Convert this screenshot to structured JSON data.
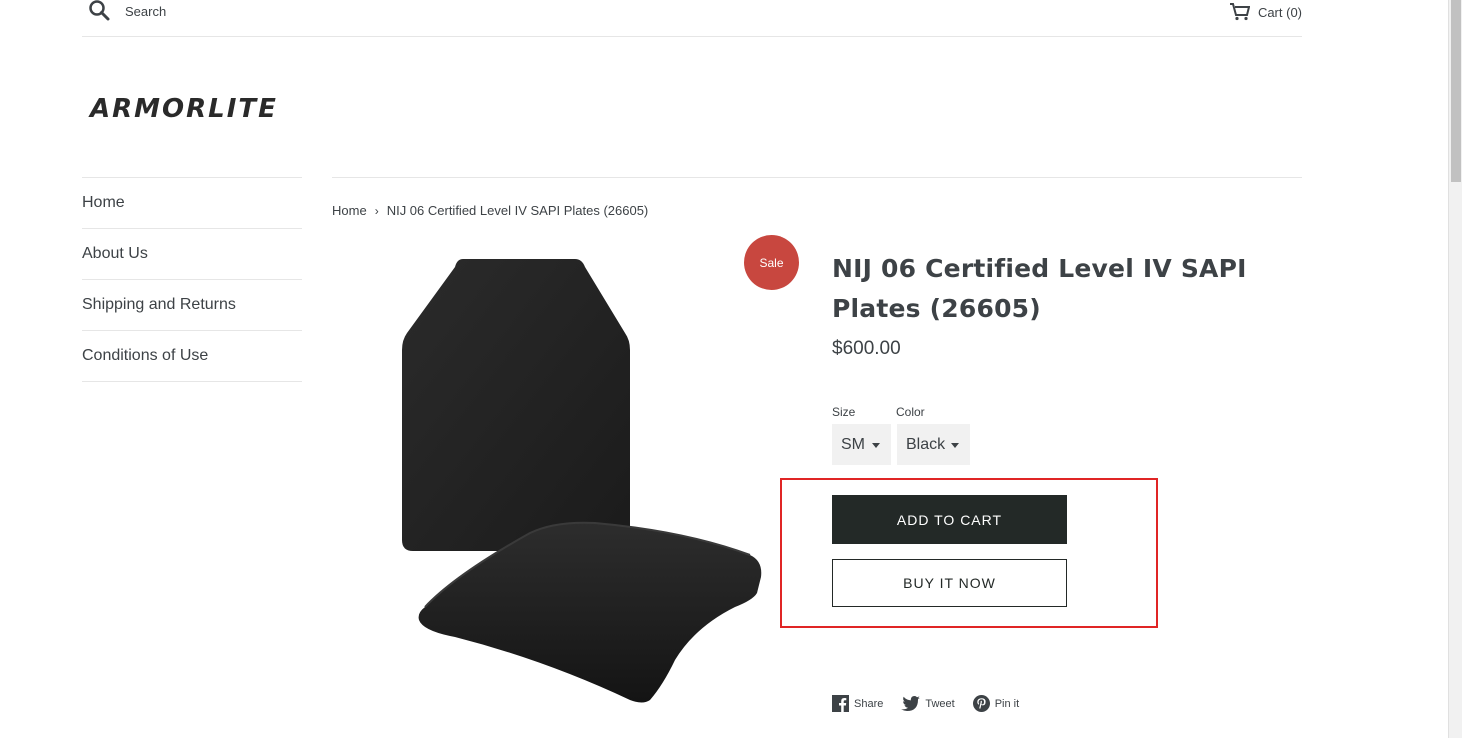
{
  "header": {
    "search_label": "Search",
    "cart_label": "Cart (0)"
  },
  "logo": {
    "text": "ARMORLITE"
  },
  "sidebar": {
    "items": [
      {
        "label": "Home"
      },
      {
        "label": "About Us"
      },
      {
        "label": "Shipping and Returns"
      },
      {
        "label": "Conditions of Use"
      }
    ]
  },
  "breadcrumb": {
    "home": "Home",
    "separator": "›",
    "current": "NIJ 06 Certified Level IV SAPI Plates (26605)"
  },
  "product": {
    "badge": "Sale",
    "title": "NIJ 06 Certified Level IV SAPI Plates (26605)",
    "price": "$600.00",
    "options": {
      "size_label": "Size",
      "size_value": "SM",
      "color_label": "Color",
      "color_value": "Black"
    },
    "add_to_cart": "ADD TO CART",
    "buy_now": "BUY IT NOW"
  },
  "share": {
    "facebook": "Share",
    "twitter": "Tweet",
    "pinterest": "Pin it"
  },
  "colors": {
    "sale_badge": "#c8473f",
    "button_dark": "#232927",
    "highlight": "#e02525",
    "text": "#3d4246"
  },
  "icons": {
    "search": "search-icon",
    "cart": "cart-icon",
    "facebook": "facebook-icon",
    "twitter": "twitter-icon",
    "pinterest": "pinterest-icon"
  }
}
